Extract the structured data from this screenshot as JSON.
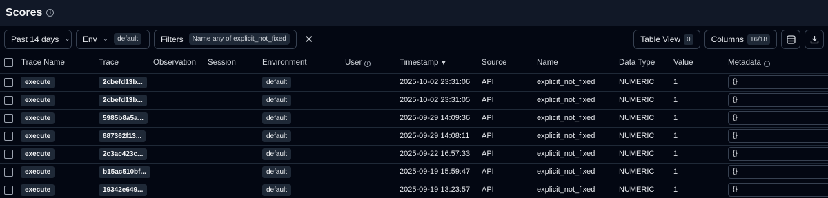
{
  "header": {
    "title": "Scores"
  },
  "toolbar": {
    "date_range": "Past 14 days",
    "env_label": "Env",
    "env_value": "default",
    "filters_label": "Filters",
    "filter_chip": "Name any of explicit_not_fixed",
    "table_view_label": "Table View",
    "table_view_count": "0",
    "columns_label": "Columns",
    "columns_count": "16/18"
  },
  "columns": {
    "trace_name": "Trace Name",
    "trace": "Trace",
    "observation": "Observation",
    "session": "Session",
    "environment": "Environment",
    "user": "User",
    "timestamp": "Timestamp",
    "source": "Source",
    "name": "Name",
    "data_type": "Data Type",
    "value": "Value",
    "metadata": "Metadata"
  },
  "rows": [
    {
      "trace_name": "execute",
      "trace": "2cbefd13b...",
      "environment": "default",
      "timestamp": "2025-10-02 23:31:06",
      "source": "API",
      "name": "explicit_not_fixed",
      "data_type": "NUMERIC",
      "value": "1",
      "metadata": "{}"
    },
    {
      "trace_name": "execute",
      "trace": "2cbefd13b...",
      "environment": "default",
      "timestamp": "2025-10-02 23:31:05",
      "source": "API",
      "name": "explicit_not_fixed",
      "data_type": "NUMERIC",
      "value": "1",
      "metadata": "{}"
    },
    {
      "trace_name": "execute",
      "trace": "5985b8a5a...",
      "environment": "default",
      "timestamp": "2025-09-29 14:09:36",
      "source": "API",
      "name": "explicit_not_fixed",
      "data_type": "NUMERIC",
      "value": "1",
      "metadata": "{}"
    },
    {
      "trace_name": "execute",
      "trace": "887362f13...",
      "environment": "default",
      "timestamp": "2025-09-29 14:08:11",
      "source": "API",
      "name": "explicit_not_fixed",
      "data_type": "NUMERIC",
      "value": "1",
      "metadata": "{}"
    },
    {
      "trace_name": "execute",
      "trace": "2c3ac423c...",
      "environment": "default",
      "timestamp": "2025-09-22 16:57:33",
      "source": "API",
      "name": "explicit_not_fixed",
      "data_type": "NUMERIC",
      "value": "1",
      "metadata": "{}"
    },
    {
      "trace_name": "execute",
      "trace": "b15ac510bf...",
      "environment": "default",
      "timestamp": "2025-09-19 15:59:47",
      "source": "API",
      "name": "explicit_not_fixed",
      "data_type": "NUMERIC",
      "value": "1",
      "metadata": "{}"
    },
    {
      "trace_name": "execute",
      "trace": "19342e649...",
      "environment": "default",
      "timestamp": "2025-09-19 13:23:57",
      "source": "API",
      "name": "explicit_not_fixed",
      "data_type": "NUMERIC",
      "value": "1",
      "metadata": "{}"
    }
  ]
}
